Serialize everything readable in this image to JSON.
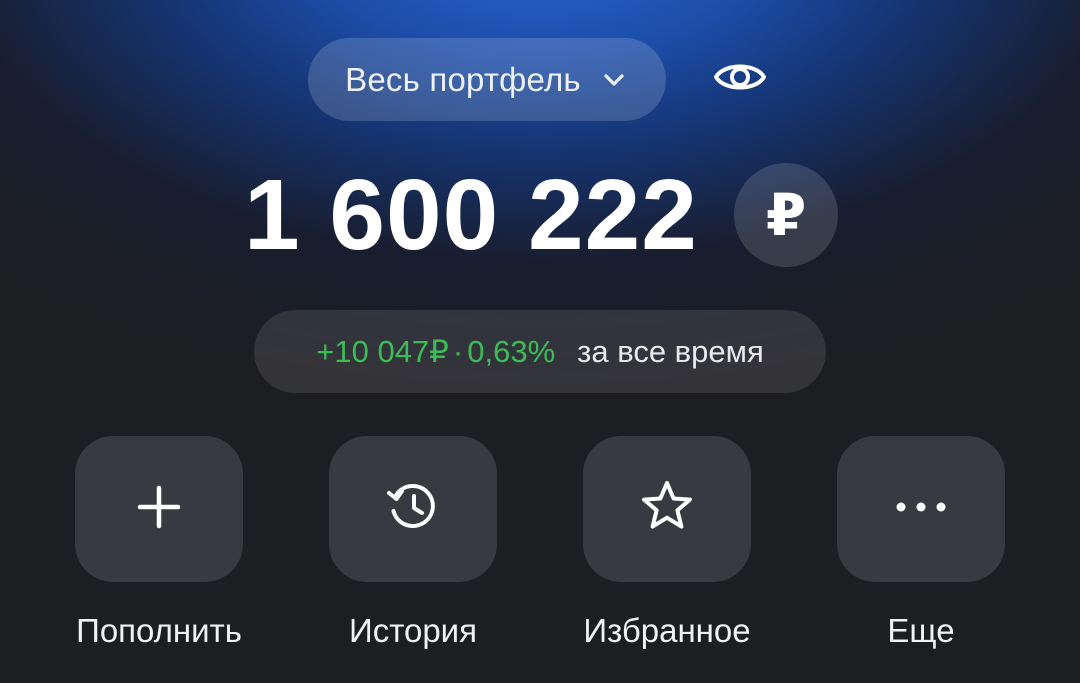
{
  "header": {
    "portfolio_label": "Весь портфель",
    "chevron_icon": "chevron-down-icon",
    "visibility_icon": "eye-icon"
  },
  "balance": {
    "amount": "1 600 222",
    "currency_symbol": "₽"
  },
  "profit": {
    "amount": "+10 047₽",
    "separator": "·",
    "percent": "0,63%",
    "period": "за все время"
  },
  "actions": [
    {
      "label": "Пополнить",
      "icon": "plus-icon"
    },
    {
      "label": "История",
      "icon": "history-icon"
    },
    {
      "label": "Избранное",
      "icon": "star-icon"
    },
    {
      "label": "Еще",
      "icon": "more-icon"
    }
  ],
  "colors": {
    "accent_blue": "#2a6ad6",
    "profit_green": "#3dbb56",
    "tile_background": "#393a3f",
    "page_background": "#1d1e22"
  }
}
